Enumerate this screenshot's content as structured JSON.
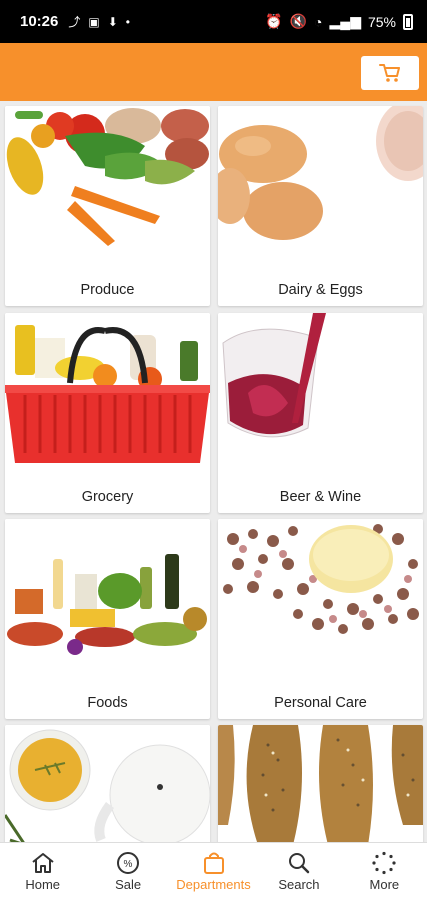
{
  "status": {
    "time": "10:26",
    "battery": "75%"
  },
  "header": {
    "cart_icon": "cart-icon"
  },
  "departments": [
    {
      "label": "Produce"
    },
    {
      "label": "Dairy & Eggs"
    },
    {
      "label": "Grocery"
    },
    {
      "label": "Beer & Wine"
    },
    {
      "label": "Foods"
    },
    {
      "label": "Personal Care"
    },
    {
      "label": ""
    },
    {
      "label": ""
    }
  ],
  "nav": {
    "home": "Home",
    "sale": "Sale",
    "departments": "Departments",
    "search": "Search",
    "more": "More"
  },
  "colors": {
    "accent": "#f7902b"
  }
}
